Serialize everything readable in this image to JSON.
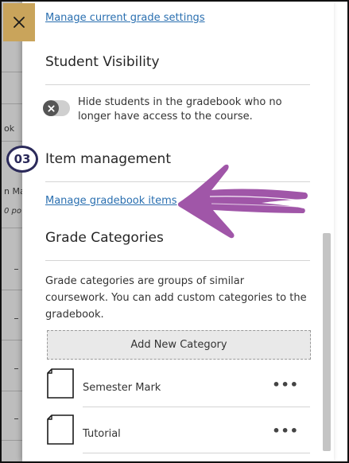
{
  "background": {
    "fragments": [
      "ok",
      "n Ma",
      "0 po"
    ]
  },
  "close_icon": "close-icon",
  "step_badge": "03",
  "panel": {
    "grade_settings_link": "Manage current grade settings",
    "student_visibility": {
      "heading": "Student Visibility",
      "toggle_label": "Hide students in the gradebook who no longer have access to the course.",
      "toggle_on": false
    },
    "item_management": {
      "heading": "Item management",
      "link": "Manage gradebook items"
    },
    "grade_categories": {
      "heading": "Grade Categories",
      "description": "Grade categories are groups of similar coursework. You can add custom categories to the gradebook.",
      "add_button": "Add New Category",
      "items": [
        {
          "label": "Semester Mark",
          "more": "•••"
        },
        {
          "label": "Tutorial",
          "more": "•••"
        }
      ]
    }
  },
  "colors": {
    "link": "#2a6fb0",
    "close_button": "#c9a45b",
    "badge": "#2b2a5a",
    "arrow": "#a056a8"
  }
}
